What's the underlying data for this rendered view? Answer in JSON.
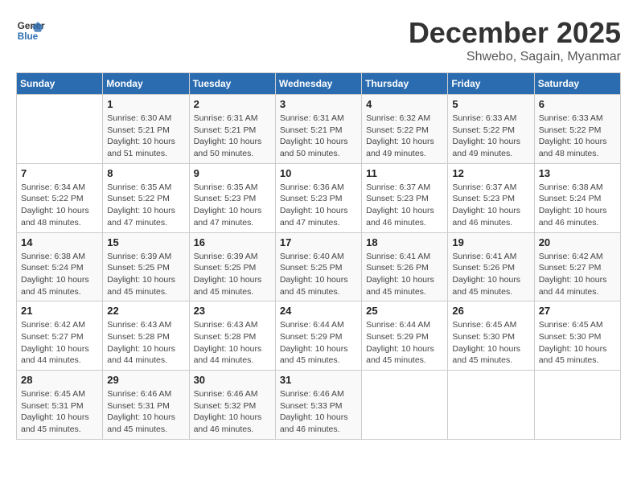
{
  "logo": {
    "text_general": "General",
    "text_blue": "Blue"
  },
  "header": {
    "month": "December 2025",
    "location": "Shwebo, Sagain, Myanmar"
  },
  "weekdays": [
    "Sunday",
    "Monday",
    "Tuesday",
    "Wednesday",
    "Thursday",
    "Friday",
    "Saturday"
  ],
  "weeks": [
    [
      {
        "day": "",
        "sunrise": "",
        "sunset": "",
        "daylight": ""
      },
      {
        "day": "1",
        "sunrise": "Sunrise: 6:30 AM",
        "sunset": "Sunset: 5:21 PM",
        "daylight": "Daylight: 10 hours and 51 minutes."
      },
      {
        "day": "2",
        "sunrise": "Sunrise: 6:31 AM",
        "sunset": "Sunset: 5:21 PM",
        "daylight": "Daylight: 10 hours and 50 minutes."
      },
      {
        "day": "3",
        "sunrise": "Sunrise: 6:31 AM",
        "sunset": "Sunset: 5:21 PM",
        "daylight": "Daylight: 10 hours and 50 minutes."
      },
      {
        "day": "4",
        "sunrise": "Sunrise: 6:32 AM",
        "sunset": "Sunset: 5:22 PM",
        "daylight": "Daylight: 10 hours and 49 minutes."
      },
      {
        "day": "5",
        "sunrise": "Sunrise: 6:33 AM",
        "sunset": "Sunset: 5:22 PM",
        "daylight": "Daylight: 10 hours and 49 minutes."
      },
      {
        "day": "6",
        "sunrise": "Sunrise: 6:33 AM",
        "sunset": "Sunset: 5:22 PM",
        "daylight": "Daylight: 10 hours and 48 minutes."
      }
    ],
    [
      {
        "day": "7",
        "sunrise": "Sunrise: 6:34 AM",
        "sunset": "Sunset: 5:22 PM",
        "daylight": "Daylight: 10 hours and 48 minutes."
      },
      {
        "day": "8",
        "sunrise": "Sunrise: 6:35 AM",
        "sunset": "Sunset: 5:22 PM",
        "daylight": "Daylight: 10 hours and 47 minutes."
      },
      {
        "day": "9",
        "sunrise": "Sunrise: 6:35 AM",
        "sunset": "Sunset: 5:23 PM",
        "daylight": "Daylight: 10 hours and 47 minutes."
      },
      {
        "day": "10",
        "sunrise": "Sunrise: 6:36 AM",
        "sunset": "Sunset: 5:23 PM",
        "daylight": "Daylight: 10 hours and 47 minutes."
      },
      {
        "day": "11",
        "sunrise": "Sunrise: 6:37 AM",
        "sunset": "Sunset: 5:23 PM",
        "daylight": "Daylight: 10 hours and 46 minutes."
      },
      {
        "day": "12",
        "sunrise": "Sunrise: 6:37 AM",
        "sunset": "Sunset: 5:23 PM",
        "daylight": "Daylight: 10 hours and 46 minutes."
      },
      {
        "day": "13",
        "sunrise": "Sunrise: 6:38 AM",
        "sunset": "Sunset: 5:24 PM",
        "daylight": "Daylight: 10 hours and 46 minutes."
      }
    ],
    [
      {
        "day": "14",
        "sunrise": "Sunrise: 6:38 AM",
        "sunset": "Sunset: 5:24 PM",
        "daylight": "Daylight: 10 hours and 45 minutes."
      },
      {
        "day": "15",
        "sunrise": "Sunrise: 6:39 AM",
        "sunset": "Sunset: 5:25 PM",
        "daylight": "Daylight: 10 hours and 45 minutes."
      },
      {
        "day": "16",
        "sunrise": "Sunrise: 6:39 AM",
        "sunset": "Sunset: 5:25 PM",
        "daylight": "Daylight: 10 hours and 45 minutes."
      },
      {
        "day": "17",
        "sunrise": "Sunrise: 6:40 AM",
        "sunset": "Sunset: 5:25 PM",
        "daylight": "Daylight: 10 hours and 45 minutes."
      },
      {
        "day": "18",
        "sunrise": "Sunrise: 6:41 AM",
        "sunset": "Sunset: 5:26 PM",
        "daylight": "Daylight: 10 hours and 45 minutes."
      },
      {
        "day": "19",
        "sunrise": "Sunrise: 6:41 AM",
        "sunset": "Sunset: 5:26 PM",
        "daylight": "Daylight: 10 hours and 45 minutes."
      },
      {
        "day": "20",
        "sunrise": "Sunrise: 6:42 AM",
        "sunset": "Sunset: 5:27 PM",
        "daylight": "Daylight: 10 hours and 44 minutes."
      }
    ],
    [
      {
        "day": "21",
        "sunrise": "Sunrise: 6:42 AM",
        "sunset": "Sunset: 5:27 PM",
        "daylight": "Daylight: 10 hours and 44 minutes."
      },
      {
        "day": "22",
        "sunrise": "Sunrise: 6:43 AM",
        "sunset": "Sunset: 5:28 PM",
        "daylight": "Daylight: 10 hours and 44 minutes."
      },
      {
        "day": "23",
        "sunrise": "Sunrise: 6:43 AM",
        "sunset": "Sunset: 5:28 PM",
        "daylight": "Daylight: 10 hours and 44 minutes."
      },
      {
        "day": "24",
        "sunrise": "Sunrise: 6:44 AM",
        "sunset": "Sunset: 5:29 PM",
        "daylight": "Daylight: 10 hours and 45 minutes."
      },
      {
        "day": "25",
        "sunrise": "Sunrise: 6:44 AM",
        "sunset": "Sunset: 5:29 PM",
        "daylight": "Daylight: 10 hours and 45 minutes."
      },
      {
        "day": "26",
        "sunrise": "Sunrise: 6:45 AM",
        "sunset": "Sunset: 5:30 PM",
        "daylight": "Daylight: 10 hours and 45 minutes."
      },
      {
        "day": "27",
        "sunrise": "Sunrise: 6:45 AM",
        "sunset": "Sunset: 5:30 PM",
        "daylight": "Daylight: 10 hours and 45 minutes."
      }
    ],
    [
      {
        "day": "28",
        "sunrise": "Sunrise: 6:45 AM",
        "sunset": "Sunset: 5:31 PM",
        "daylight": "Daylight: 10 hours and 45 minutes."
      },
      {
        "day": "29",
        "sunrise": "Sunrise: 6:46 AM",
        "sunset": "Sunset: 5:31 PM",
        "daylight": "Daylight: 10 hours and 45 minutes."
      },
      {
        "day": "30",
        "sunrise": "Sunrise: 6:46 AM",
        "sunset": "Sunset: 5:32 PM",
        "daylight": "Daylight: 10 hours and 46 minutes."
      },
      {
        "day": "31",
        "sunrise": "Sunrise: 6:46 AM",
        "sunset": "Sunset: 5:33 PM",
        "daylight": "Daylight: 10 hours and 46 minutes."
      },
      {
        "day": "",
        "sunrise": "",
        "sunset": "",
        "daylight": ""
      },
      {
        "day": "",
        "sunrise": "",
        "sunset": "",
        "daylight": ""
      },
      {
        "day": "",
        "sunrise": "",
        "sunset": "",
        "daylight": ""
      }
    ]
  ]
}
